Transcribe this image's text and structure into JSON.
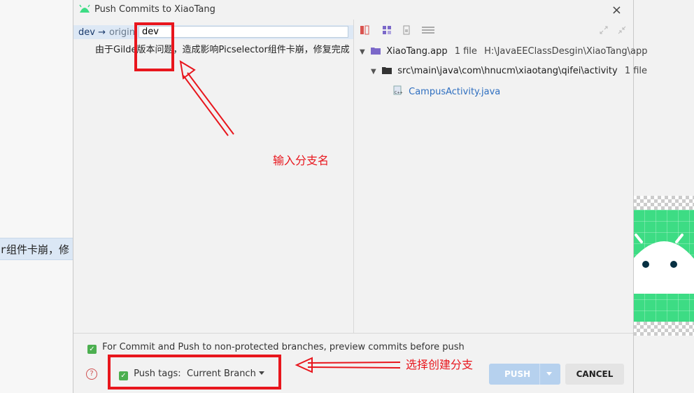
{
  "background": {
    "editor_fragment": "r组件卡崩，修"
  },
  "dialog": {
    "title": "Push Commits to XiaoTang",
    "close_glyph": "×"
  },
  "commits": {
    "local_branch": "dev",
    "arrow": "→",
    "remote": "origin",
    "target_branch_value": "dev",
    "message": "由于Gilde版本问题，造成影响Picselector组件卡崩，修复完成"
  },
  "changes_tree": {
    "root": {
      "name": "XiaoTang.app",
      "count": "1 file",
      "path": "H:\\JavaEEClassDesgin\\XiaoTang\\app"
    },
    "folder": {
      "name": "src\\main\\java\\com\\hnucm\\xiaotang\\qifei\\activity",
      "count": "1 file"
    },
    "file": {
      "name": "CampusActivity.java"
    }
  },
  "options": {
    "preview_label": "For Commit and Push to non-protected branches, preview commits before push",
    "push_tags_label": "Push tags:",
    "push_tags_value": "Current Branch"
  },
  "buttons": {
    "push": "PUSH",
    "cancel": "CANCEL"
  },
  "annotations": {
    "branch_hint": "输入分支名",
    "tags_hint": "选择创建分支"
  },
  "colors": {
    "annotation_red": "#e8161d",
    "accent_blue": "#2f6fc0",
    "check_green": "#4caf50"
  }
}
